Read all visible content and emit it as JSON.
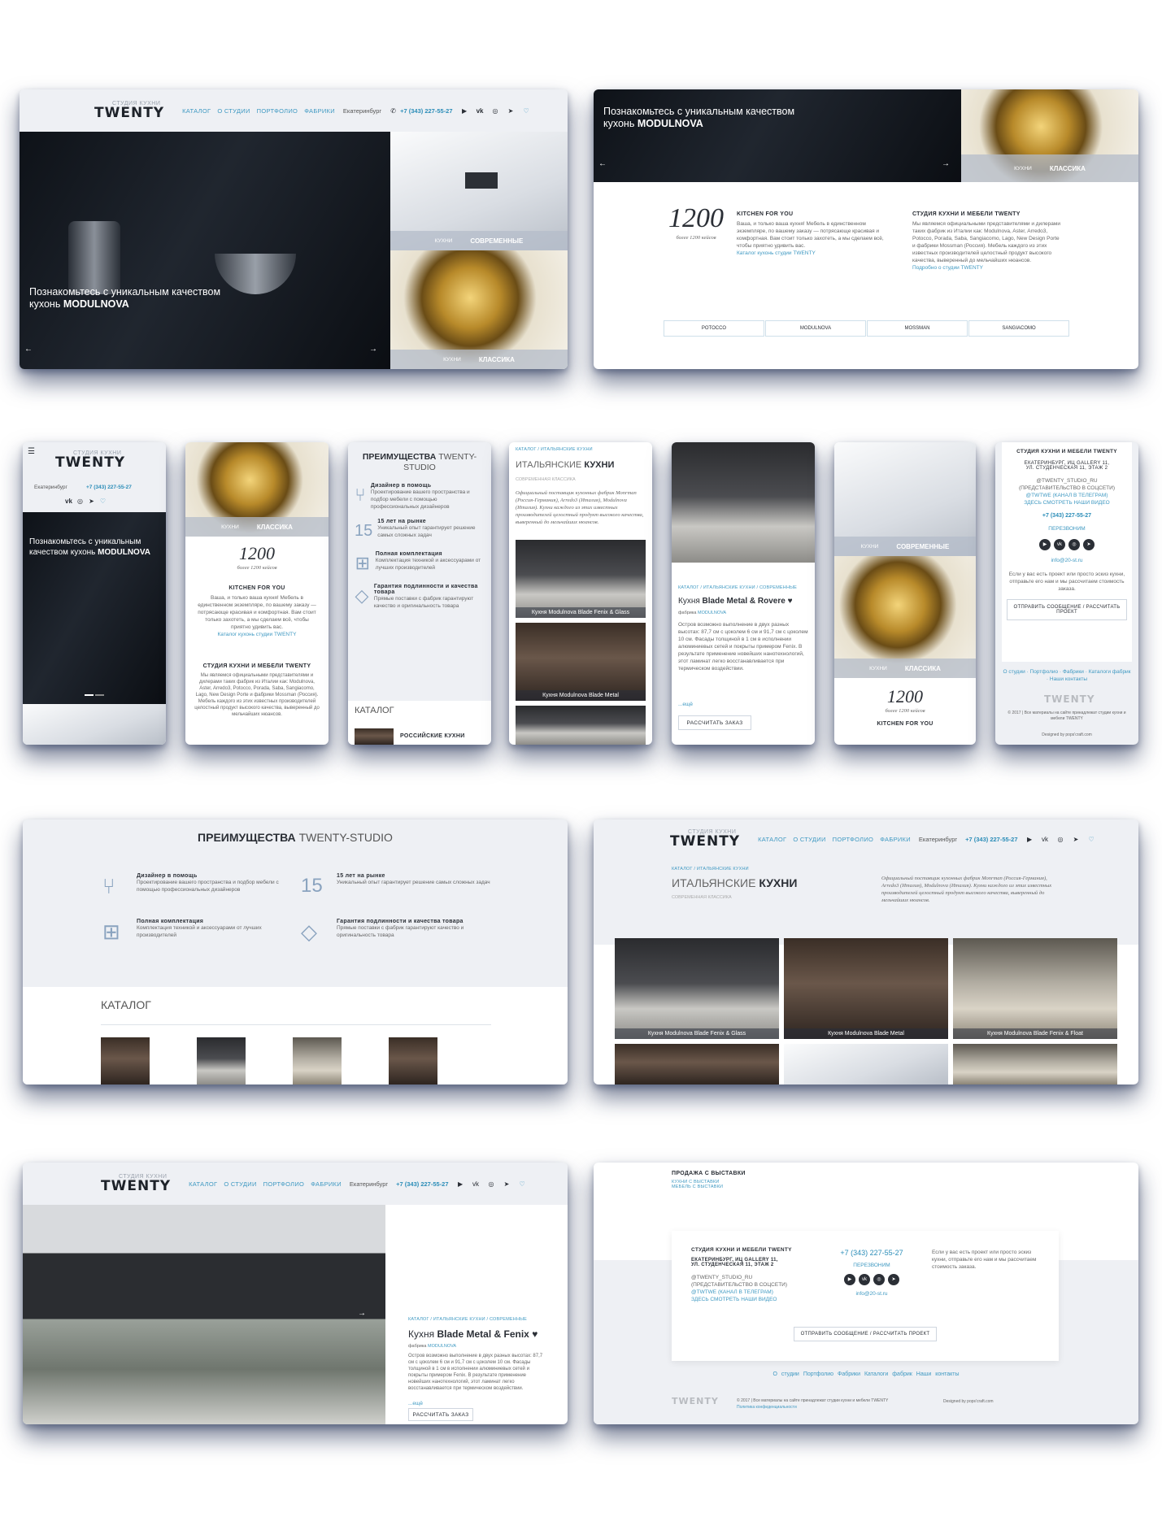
{
  "header": {
    "logo_sub": "СТУДИЯ КУХНИ",
    "logo_main": "TWENTY",
    "nav": [
      "КАТАЛОГ",
      "О СТУДИИ",
      "ПОРТФОЛИО",
      "ФАБРИКИ"
    ],
    "city": "Екатеринбург",
    "phone": "+7 (343) 227-55-27"
  },
  "hero": {
    "line1": "Познакомьтесь с уникальным качеством",
    "line2_prefix": "кухонь ",
    "line2_brand": "MODULNOVA",
    "tile1_small": "КУХНИ",
    "tile1_label": "СОВРЕМЕННЫЕ",
    "tile2_small": "КУХНИ",
    "tile2_label": "КЛАССИКА"
  },
  "intro": {
    "number": "1200",
    "number_caption": "более 1200 кейсов",
    "kfy_title": "KITCHEN FOR YOU",
    "kfy_text": "Ваша, и только ваша кухня! Мебель в единственном экземпляре, по вашему заказу — потрясающе красивая и комфортная. Вам стоит только захотеть, а мы сделаем всё, чтобы приятно удивить вас.",
    "kfy_link": "Каталог кухонь студии TWENTY",
    "studio_title": "СТУДИЯ КУХНИ И МЕБЕЛИ TWENTY",
    "studio_text": "Мы являемся официальными представителями и дилерами таких фабрик из Италии как: Modulnova, Aster, Arredo3, Potocco, Porada, Saba, Sangiacomo, Lago, New Design Porte и фабрики Mossman (Россия). Мебель каждого из этих известных производителей целостный продукт высокого качества, выверенный до мельчайших нюансов.",
    "studio_link": "Подробно о студии TWENTY",
    "brands": [
      "POTOCCO",
      "MODULNOVA",
      "MOSSMAN",
      "SANGIACOMO"
    ]
  },
  "advantages": {
    "title_bold": "ПРЕИМУЩЕСТВА",
    "title_light": "TWENTY-STUDIO",
    "items": [
      {
        "title": "Дизайнер в помощь",
        "text": "Проектирование вашего пространства и подбор мебели с помощью профессиональных дизайнеров",
        "icon": "chair-icon"
      },
      {
        "title": "15 лет на рынке",
        "text": "Уникальный опыт гарантирует решение самых сложных задач",
        "icon": "fifteen-icon"
      },
      {
        "title": "Полная комплектация",
        "text": "Комплектация техникой и аксессуарами от лучших производителей",
        "icon": "cooktop-icon"
      },
      {
        "title": "Гарантия подлинности и качества товара",
        "text": "Прямые поставки с фабрик гарантируют качество и оригинальность товара",
        "icon": "diamond-icon"
      }
    ],
    "catalog_title": "КАТАЛОГ",
    "catalog_first": "РОССИЙСКИЕ КУХНИ"
  },
  "italian": {
    "crumbs": [
      "КАТАЛОГ",
      "ИТАЛЬЯНСКИЕ КУХНИ"
    ],
    "title_light": "ИТАЛЬЯНСКИЕ",
    "title_bold": "КУХНИ",
    "subtitle": "СОВРЕМЕННАЯ КЛАССИКА",
    "desc": "Официальный поставщик кухонных фабрик Monrman (Россия-Германия), Arredo3 (Италия), Modulnova (Италия). Кухни каждого из этих известных производителей целостный продукт высокого качества, выверенный до мельчайших нюансов.",
    "cards": [
      "Кухня Modulnova Blade Fenix & Glass",
      "Кухня Modulnova Blade Metal",
      "Кухня Modulnova Blade Fenix & Float"
    ]
  },
  "product": {
    "crumbs": [
      "КАТАЛОГ",
      "ИТАЛЬЯНСКИЕ КУХНИ",
      "СОВРЕМЕННЫЕ"
    ],
    "title_light": "Кухня",
    "title_bold": "Blade Metal & Fenix",
    "mobile_title_bold": "Blade Metal & Rovere",
    "factory_label": "фабрика",
    "factory": "MODULNOVA",
    "text": "Остров возможно выполнение в двух разных высотах: 87,7 см с цоколем 6 см и 91,7 см с цоколем 10 см. Фасады толщиной в 1 см в исполнении алюминиевых сетей и покрыты примером Fenix. В результате применение новейших нанотехнологий, этот ламинат легко восстанавливается при термическом воздействии.",
    "more": "...ещё",
    "order": "РАССЧИТАТЬ ЗАКАЗ"
  },
  "sale": {
    "title": "ПРОДАЖА С ВЫСТАВКИ",
    "links": [
      "КУХНИ С ВЫСТАВКИ",
      "МЕБЕЛЬ С ВЫСТАВКИ"
    ]
  },
  "footer": {
    "studio": "СТУДИЯ КУХНИ И МЕБЕЛИ TWENTY",
    "address1": "ЕКАТЕРИНБУРГ, ИЦ GALLERY 11,",
    "address2": "УЛ. СТУДЕНЧЕСКАЯ 11, ЭТАЖ 2",
    "social1": "@TWENTY_STUDIO_RU",
    "social2": "(ПРЕДСТАВИТЕЛЬСТВО В СОЦСЕТИ)",
    "social3": "@TWTWE",
    "social3_tail": "(КАНАЛ В ТЕЛЕГРАМ)",
    "social4": "ЗДЕСЬ СМОТРЕТЬ НАШИ ВИДЕО",
    "phone": "+7 (343) 227-55-27",
    "callback": "ПЕРЕЗВОНИМ",
    "email": "info@20-st.ru",
    "proposal": "Если у вас есть проект или просто эскиз кухни, отправьте его нам и мы рассчитаем стоимость заказа.",
    "send": "ОТПРАВИТЬ СООБЩЕНИЕ / РАССЧИТАТЬ ПРОЕКТ",
    "links": [
      "О студии",
      "Портфолио",
      "Фабрики",
      "Каталоги фабрик",
      "Наши контакты"
    ],
    "copyright": "© 2017 | Все материалы на сайте принадлежат студии кухни и мебели TWENTY",
    "privacy": "Политика конфиденциальности",
    "designed": "Designed by pops'craft.com"
  },
  "colors": {
    "accent": "#3f99c2",
    "dark_bg": "#0f1b3d",
    "panel": "#eef0f4"
  }
}
